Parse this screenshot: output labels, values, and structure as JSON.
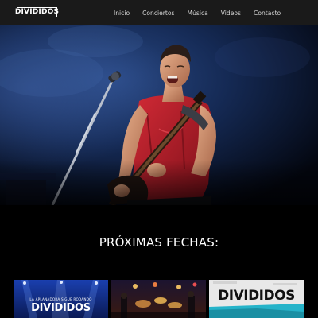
{
  "navbar": {
    "logo_text": "DIVIDIDOS",
    "items": [
      {
        "label": "Inicio"
      },
      {
        "label": "Conciertos"
      },
      {
        "label": "Música"
      },
      {
        "label": "Videos"
      },
      {
        "label": "Contacto"
      }
    ]
  },
  "hero": {
    "image": "guitarist-performing-on-stage-photo"
  },
  "section": {
    "title": "PRÓXIMAS FECHAS:"
  },
  "cards": [
    {
      "subtitle": "LA APLANADORA SIGUE RODANDO",
      "title": "DIVIDIDOS"
    },
    {
      "image": "band-live-concert-photo"
    },
    {
      "title": "DIVIDIDOS"
    }
  ],
  "colors": {
    "navbar_bg": "#1a1a1a",
    "page_bg": "#000000",
    "text": "#ffffff"
  }
}
